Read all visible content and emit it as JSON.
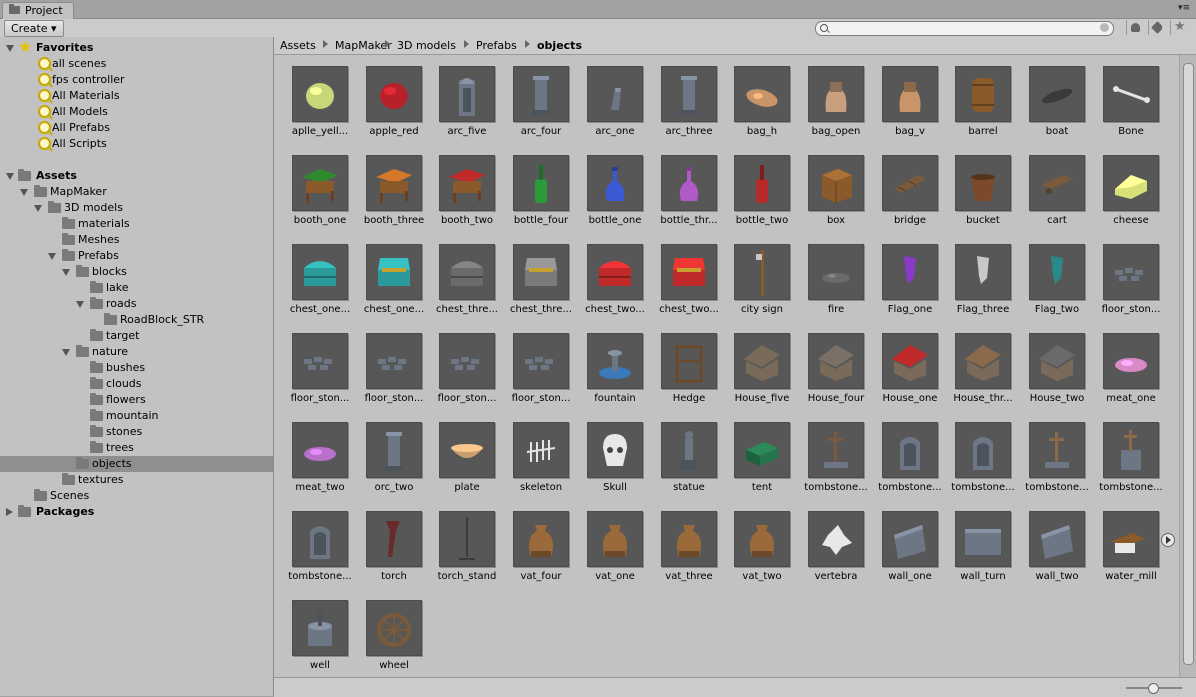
{
  "window": {
    "tab_title": "Project",
    "window_controls": "▾≡"
  },
  "toolbar": {
    "create_label": "Create ▾",
    "search_placeholder": "",
    "star_glyph": "★"
  },
  "breadcrumb": [
    "Assets",
    "MapMaker",
    "3D models",
    "Prefabs",
    "objects"
  ],
  "tree": [
    {
      "label": "Favorites",
      "depth": 0,
      "expander": "open",
      "icon": "star-icon",
      "bold": true
    },
    {
      "label": "all scenes",
      "depth": 1,
      "expander": "none",
      "icon": "search-icon"
    },
    {
      "label": "fps controller",
      "depth": 1,
      "expander": "none",
      "icon": "search-icon"
    },
    {
      "label": "All Materials",
      "depth": 1,
      "expander": "none",
      "icon": "search-icon"
    },
    {
      "label": "All Models",
      "depth": 1,
      "expander": "none",
      "icon": "search-icon"
    },
    {
      "label": "All Prefabs",
      "depth": 1,
      "expander": "none",
      "icon": "search-icon"
    },
    {
      "label": "All Scripts",
      "depth": 1,
      "expander": "none",
      "icon": "search-icon"
    },
    {
      "label": "",
      "depth": 0,
      "expander": "none",
      "icon": "none",
      "spacer": true
    },
    {
      "label": "Assets",
      "depth": 0,
      "expander": "open",
      "icon": "folder-icon",
      "bold": true
    },
    {
      "label": "MapMaker",
      "depth": 1,
      "expander": "open",
      "icon": "folder-icon"
    },
    {
      "label": "3D models",
      "depth": 2,
      "expander": "open",
      "icon": "folder-icon"
    },
    {
      "label": "materials",
      "depth": 3,
      "expander": "none",
      "icon": "folder-icon"
    },
    {
      "label": "Meshes",
      "depth": 3,
      "expander": "none",
      "icon": "folder-icon"
    },
    {
      "label": "Prefabs",
      "depth": 3,
      "expander": "open",
      "icon": "folder-icon"
    },
    {
      "label": "blocks",
      "depth": 4,
      "expander": "open",
      "icon": "folder-icon"
    },
    {
      "label": "lake",
      "depth": 5,
      "expander": "none",
      "icon": "folder-icon"
    },
    {
      "label": "roads",
      "depth": 5,
      "expander": "open",
      "icon": "folder-icon"
    },
    {
      "label": "RoadBlock_STR",
      "depth": 6,
      "expander": "none",
      "icon": "folder-icon"
    },
    {
      "label": "target",
      "depth": 5,
      "expander": "none",
      "icon": "folder-icon"
    },
    {
      "label": "nature",
      "depth": 4,
      "expander": "open",
      "icon": "folder-icon"
    },
    {
      "label": "bushes",
      "depth": 5,
      "expander": "none",
      "icon": "folder-icon"
    },
    {
      "label": "clouds",
      "depth": 5,
      "expander": "none",
      "icon": "folder-icon"
    },
    {
      "label": "flowers",
      "depth": 5,
      "expander": "none",
      "icon": "folder-icon"
    },
    {
      "label": "mountain",
      "depth": 5,
      "expander": "none",
      "icon": "folder-icon"
    },
    {
      "label": "stones",
      "depth": 5,
      "expander": "none",
      "icon": "folder-icon"
    },
    {
      "label": "trees",
      "depth": 5,
      "expander": "none",
      "icon": "folder-icon"
    },
    {
      "label": "objects",
      "depth": 4,
      "expander": "none",
      "icon": "folder-icon",
      "selected": true
    },
    {
      "label": "textures",
      "depth": 3,
      "expander": "none",
      "icon": "folder-icon"
    },
    {
      "label": "Scenes",
      "depth": 1,
      "expander": "none",
      "icon": "folder-icon"
    },
    {
      "label": "Packages",
      "depth": 0,
      "expander": "closed",
      "icon": "folder-icon",
      "bold": true
    }
  ],
  "assets": [
    {
      "label": "aplle_yell...",
      "shape": "sphere",
      "color": "#c8d67a"
    },
    {
      "label": "apple_red",
      "shape": "sphere",
      "color": "#b8202a"
    },
    {
      "label": "arc_five",
      "shape": "arch",
      "color": "#6d7684"
    },
    {
      "label": "arc_four",
      "shape": "pillar",
      "color": "#6d7684"
    },
    {
      "label": "arc_one",
      "shape": "small",
      "color": "#6d7684"
    },
    {
      "label": "arc_three",
      "shape": "pillar",
      "color": "#6d7684"
    },
    {
      "label": "bag_h",
      "shape": "sack",
      "color": "#c99468"
    },
    {
      "label": "bag_open",
      "shape": "bag",
      "color": "#c8a080"
    },
    {
      "label": "bag_v",
      "shape": "bag",
      "color": "#c99468"
    },
    {
      "label": "barrel",
      "shape": "barrel",
      "color": "#8a5a2a"
    },
    {
      "label": "boat",
      "shape": "boat",
      "color": "#3a3a3a"
    },
    {
      "label": "Bone",
      "shape": "bone",
      "color": "#e4e4e4"
    },
    {
      "label": "booth_one",
      "shape": "booth",
      "color": "#2f8a2f"
    },
    {
      "label": "booth_three",
      "shape": "booth",
      "color": "#d6782a"
    },
    {
      "label": "booth_two",
      "shape": "booth",
      "color": "#c02a2a"
    },
    {
      "label": "bottle_four",
      "shape": "bottle",
      "color": "#2a9a3a"
    },
    {
      "label": "bottle_one",
      "shape": "flask",
      "color": "#3a5ad6"
    },
    {
      "label": "bottle_thr...",
      "shape": "flask",
      "color": "#b05ac8"
    },
    {
      "label": "bottle_two",
      "shape": "bottle",
      "color": "#b82a2a"
    },
    {
      "label": "box",
      "shape": "box",
      "color": "#8a5a2a"
    },
    {
      "label": "bridge",
      "shape": "bridge",
      "color": "#7a5a3a"
    },
    {
      "label": "bucket",
      "shape": "bucket",
      "color": "#7a4a2a"
    },
    {
      "label": "cart",
      "shape": "cart",
      "color": "#7a5a3a"
    },
    {
      "label": "cheese",
      "shape": "cheese",
      "color": "#d8e07a"
    },
    {
      "label": "chest_one...",
      "shape": "chest",
      "color": "#2a9a9a"
    },
    {
      "label": "chest_one...",
      "shape": "chestopen",
      "color": "#2a9a9a"
    },
    {
      "label": "chest_thre...",
      "shape": "chest",
      "color": "#6a6a6a"
    },
    {
      "label": "chest_thre...",
      "shape": "chestopen",
      "color": "#7a7a7a"
    },
    {
      "label": "chest_two...",
      "shape": "chest",
      "color": "#c02a2a"
    },
    {
      "label": "chest_two...",
      "shape": "chestopen",
      "color": "#c02a2a"
    },
    {
      "label": "city sign",
      "shape": "sign",
      "color": "#8a5a2a"
    },
    {
      "label": "fire",
      "shape": "fire",
      "color": "#6a6a6a"
    },
    {
      "label": "Flag_one",
      "shape": "flag",
      "color": "#8a3ac8"
    },
    {
      "label": "Flag_three",
      "shape": "flag",
      "color": "#c8c8c8"
    },
    {
      "label": "Flag_two",
      "shape": "flag",
      "color": "#2a8a8a"
    },
    {
      "label": "floor_ston...",
      "shape": "tiles",
      "color": "#6d7684"
    },
    {
      "label": "floor_ston...",
      "shape": "tiles",
      "color": "#6d7684"
    },
    {
      "label": "floor_ston...",
      "shape": "tiles",
      "color": "#6d7684"
    },
    {
      "label": "floor_ston...",
      "shape": "tiles",
      "color": "#6d7684"
    },
    {
      "label": "floor_ston...",
      "shape": "tiles",
      "color": "#6d7684"
    },
    {
      "label": "fountain",
      "shape": "fountain",
      "color": "#3a7ab8"
    },
    {
      "label": "Hedge",
      "shape": "hedge",
      "color": "#6a4a2a"
    },
    {
      "label": "House_five",
      "shape": "house",
      "color": "#7a6a5a"
    },
    {
      "label": "House_four",
      "shape": "house",
      "color": "#7a7068"
    },
    {
      "label": "House_one",
      "shape": "house",
      "color": "#c02a2a"
    },
    {
      "label": "House_thr...",
      "shape": "house",
      "color": "#8a6a4a"
    },
    {
      "label": "House_two",
      "shape": "house",
      "color": "#6a6a6a"
    },
    {
      "label": "meat_one",
      "shape": "meat",
      "color": "#d88ac8"
    },
    {
      "label": "meat_two",
      "shape": "meat",
      "color": "#b870c8"
    },
    {
      "label": "orc_two",
      "shape": "pillar",
      "color": "#6d7684"
    },
    {
      "label": "plate",
      "shape": "plate",
      "color": "#c8a070"
    },
    {
      "label": "skeleton",
      "shape": "skeleton",
      "color": "#e4e4e4"
    },
    {
      "label": "Skull",
      "shape": "skull",
      "color": "#e8e8e8"
    },
    {
      "label": "statue",
      "shape": "statue",
      "color": "#6d7684"
    },
    {
      "label": "tent",
      "shape": "tent",
      "color": "#2a8a5a"
    },
    {
      "label": "tombstone...",
      "shape": "cross",
      "color": "#7a5a3a"
    },
    {
      "label": "tombstone...",
      "shape": "tomb",
      "color": "#6d7684"
    },
    {
      "label": "tombstone...",
      "shape": "tomb",
      "color": "#6d7684"
    },
    {
      "label": "tombstone...",
      "shape": "cross",
      "color": "#8a6a4a"
    },
    {
      "label": "tombstone...",
      "shape": "crosstomb",
      "color": "#6d7684"
    },
    {
      "label": "tombstone...",
      "shape": "tomb",
      "color": "#6d7684"
    },
    {
      "label": "torch",
      "shape": "torch",
      "color": "#6a2a2a"
    },
    {
      "label": "torch_stand",
      "shape": "stand",
      "color": "#3a3a3a"
    },
    {
      "label": "vat_four",
      "shape": "vase",
      "color": "#9a6a3a"
    },
    {
      "label": "vat_one",
      "shape": "vase",
      "color": "#9a6a3a"
    },
    {
      "label": "vat_three",
      "shape": "vase",
      "color": "#9a6a3a"
    },
    {
      "label": "vat_two",
      "shape": "vase",
      "color": "#9a6a3a"
    },
    {
      "label": "vertebra",
      "shape": "vertebra",
      "color": "#e8e8e8"
    },
    {
      "label": "wall_one",
      "shape": "wall",
      "color": "#6d7684"
    },
    {
      "label": "wall_turn",
      "shape": "wallturn",
      "color": "#6d7684"
    },
    {
      "label": "wall_two",
      "shape": "wall",
      "color": "#6d7684"
    },
    {
      "label": "water_mill",
      "shape": "mill",
      "color": "#8a5a2a"
    },
    {
      "label": "well",
      "shape": "well",
      "color": "#6d7684"
    },
    {
      "label": "wheel",
      "shape": "wheel",
      "color": "#7a5a3a"
    }
  ]
}
